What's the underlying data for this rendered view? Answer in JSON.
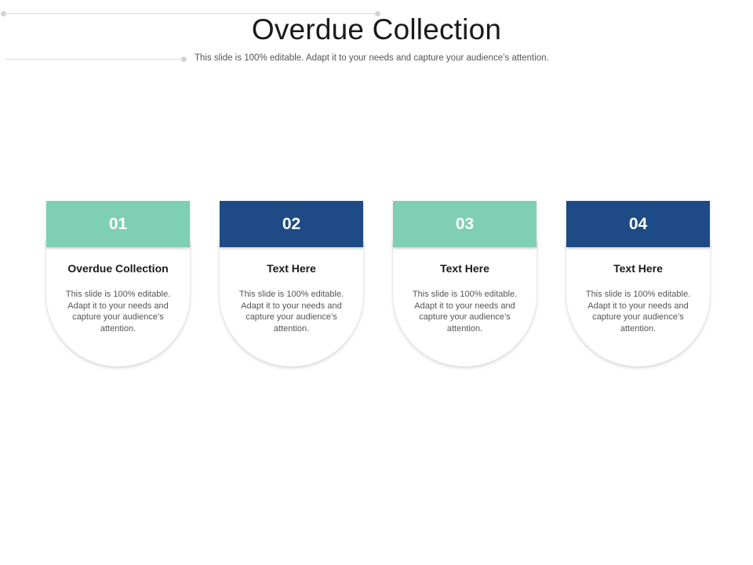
{
  "slide": {
    "title": "Overdue Collection",
    "subtitle": "This slide is 100% editable. Adapt it to your needs and capture your audience’s attention."
  },
  "colors": {
    "teal": "#7ecfb3",
    "navy": "#1e4b86"
  },
  "cards": [
    {
      "number": "01",
      "title": "Overdue Collection",
      "text": "This slide is 100% editable. Adapt it to your needs and capture your audience’s attention.",
      "color": "#7ecfb3"
    },
    {
      "number": "02",
      "title": "Text Here",
      "text": "This slide is 100% editable. Adapt it to your needs and capture your audience’s attention.",
      "color": "#1e4b86"
    },
    {
      "number": "03",
      "title": "Text Here",
      "text": "This slide is 100% editable. Adapt it to your needs and capture your audience’s attention.",
      "color": "#7ecfb3"
    },
    {
      "number": "04",
      "title": "Text Here",
      "text": "This slide is 100% editable. Adapt it to your needs and capture your audience’s attention.",
      "color": "#1e4b86"
    }
  ]
}
